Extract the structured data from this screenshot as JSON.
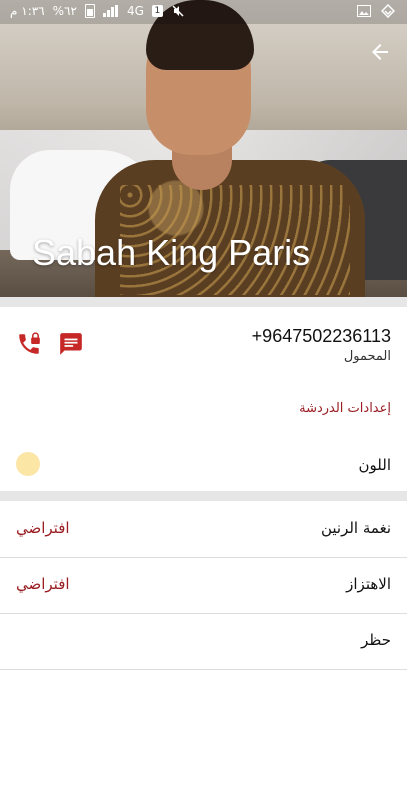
{
  "status_bar": {
    "time": "١:٣٦ م",
    "battery_text": "%٦٢",
    "network": "4G",
    "sim": "1"
  },
  "header": {
    "contact_name": "Sabah King Paris"
  },
  "contact": {
    "phone_number": "+9647502236113",
    "phone_type": "المحمول"
  },
  "sections": {
    "chat_settings": "إعدادات الدردشة",
    "color_label": "اللون",
    "color_value": "#fbe6a6"
  },
  "settings_rows": [
    {
      "label": "نغمة الرنين",
      "value": "افتراضي"
    },
    {
      "label": "الاهتزاز",
      "value": "افتراضي"
    },
    {
      "label": "حظر",
      "value": ""
    }
  ],
  "colors": {
    "accent": "#9a1d22",
    "divider": "#e6e6e6"
  }
}
